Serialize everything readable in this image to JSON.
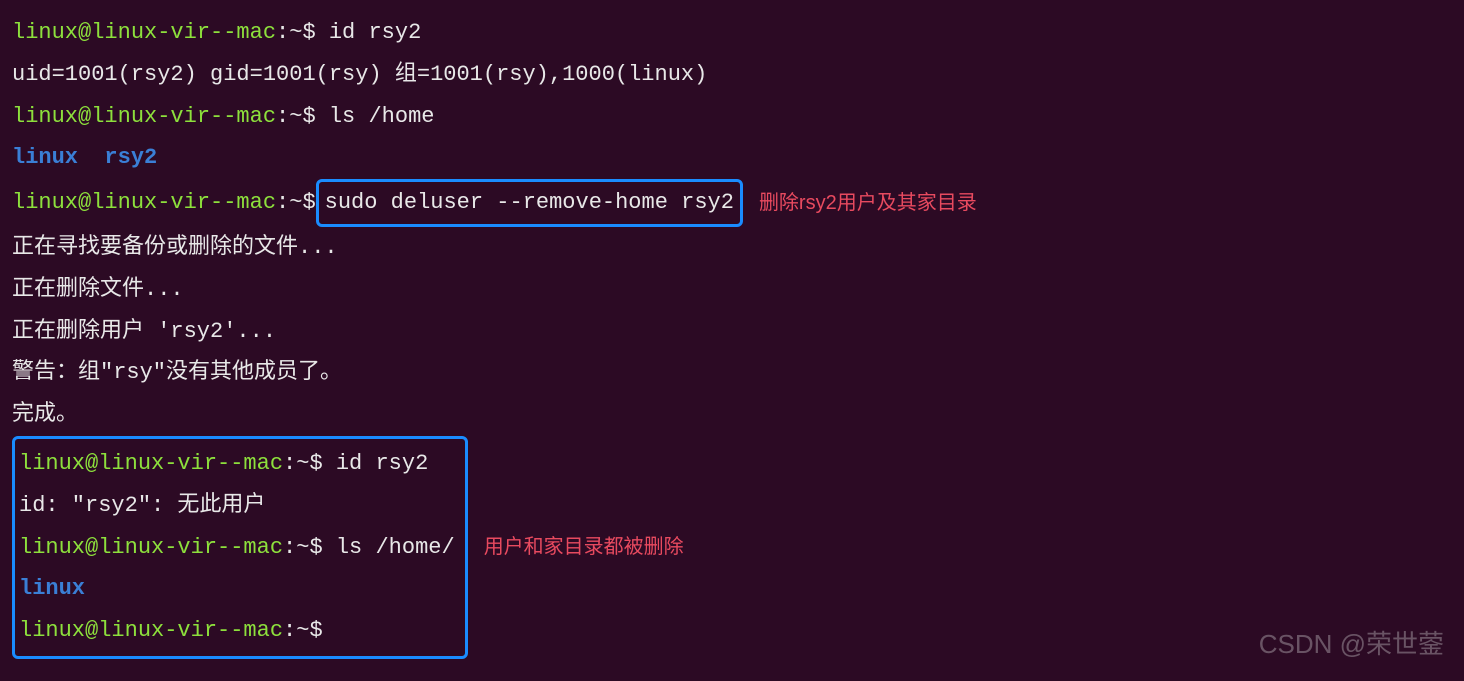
{
  "prompt": {
    "user_host": "linux@linux-vir--mac",
    "path": ":~",
    "dollar": "$"
  },
  "lines": {
    "cmd1": "id rsy2",
    "out1": "uid=1001(rsy2) gid=1001(rsy) 组=1001(rsy),1000(linux)",
    "cmd2": "ls /home",
    "out2a": "linux",
    "out2b": "rsy2",
    "cmd3": "sudo deluser --remove-home rsy2",
    "annot3": "删除rsy2用户及其家目录",
    "out3a": "正在寻找要备份或删除的文件...",
    "out3b": "正在删除文件...",
    "out3c": "正在删除用户 'rsy2'...",
    "out3d": "警告：组\"rsy\"没有其他成员了。",
    "out3e": "完成。",
    "cmd4": "id rsy2",
    "out4": "id: \"rsy2\": 无此用户",
    "cmd5": "ls /home/",
    "out5": "linux",
    "annot4": "用户和家目录都被删除"
  },
  "watermark": "CSDN @荣世蓥"
}
